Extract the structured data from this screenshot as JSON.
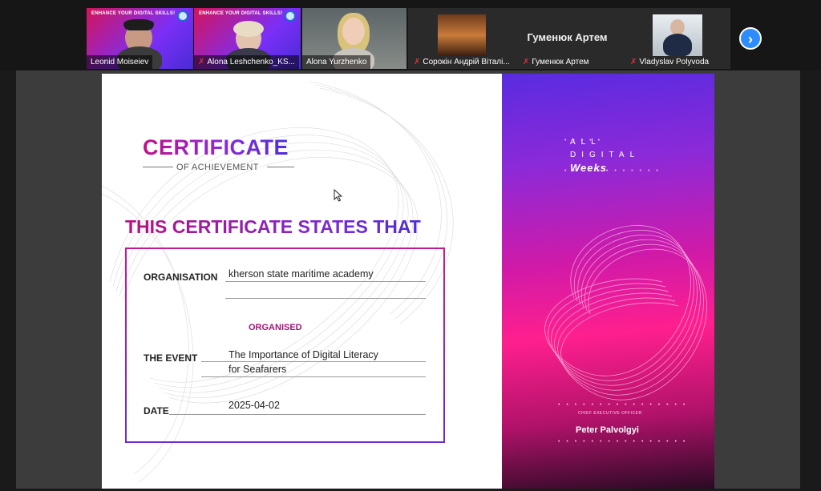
{
  "participants": [
    {
      "name": "Leonid Moiseiev",
      "muted": false,
      "active": true,
      "banner": "ENHANCE YOUR DIGITAL SKILLS!"
    },
    {
      "name": "Alona Leshchenko_KS...",
      "muted": true,
      "active": false,
      "banner": "ENHANCE YOUR DIGITAL SKILLS!"
    },
    {
      "name": "Alona Yurzhenko",
      "muted": false,
      "active": false
    },
    {
      "name": "Сорокін Андрій Віталі...",
      "muted": true,
      "active": false
    },
    {
      "name": "Гуменюк Артем",
      "muted": true,
      "active": false,
      "display_name": "Гуменюк Артем"
    },
    {
      "name": "Vladyslav Polyvoda",
      "muted": true,
      "active": false
    }
  ],
  "next_page_icon": "chevron-right-icon",
  "certificate": {
    "title": "CERTIFICATE",
    "subtitle": "OF ACHIEVEMENT",
    "states_heading": "THIS CERTIFICATE STATES THAT",
    "organisation_label": "ORGANISATION",
    "organisation_value": "kherson state maritime academy",
    "organised_label": "ORGANISED",
    "event_label": "THE EVENT",
    "event_value_line1": "The Importance of Digital Literacy",
    "event_value_line2": "for Seafarers",
    "date_label": "DATE",
    "date_value": "2025-04-02",
    "brand_line1": "ALL",
    "brand_line2": "DIGITAL",
    "brand_line3": "Weeks",
    "ceo_title": "CHIEF EXECUTIVE OFFICER",
    "ceo_name": "Peter Palvolgyi"
  },
  "colors": {
    "active_speaker": "#2fd37a",
    "muted_mic": "#e0303a",
    "accent_magenta": "#c0108a",
    "accent_purple": "#5a2be0"
  }
}
